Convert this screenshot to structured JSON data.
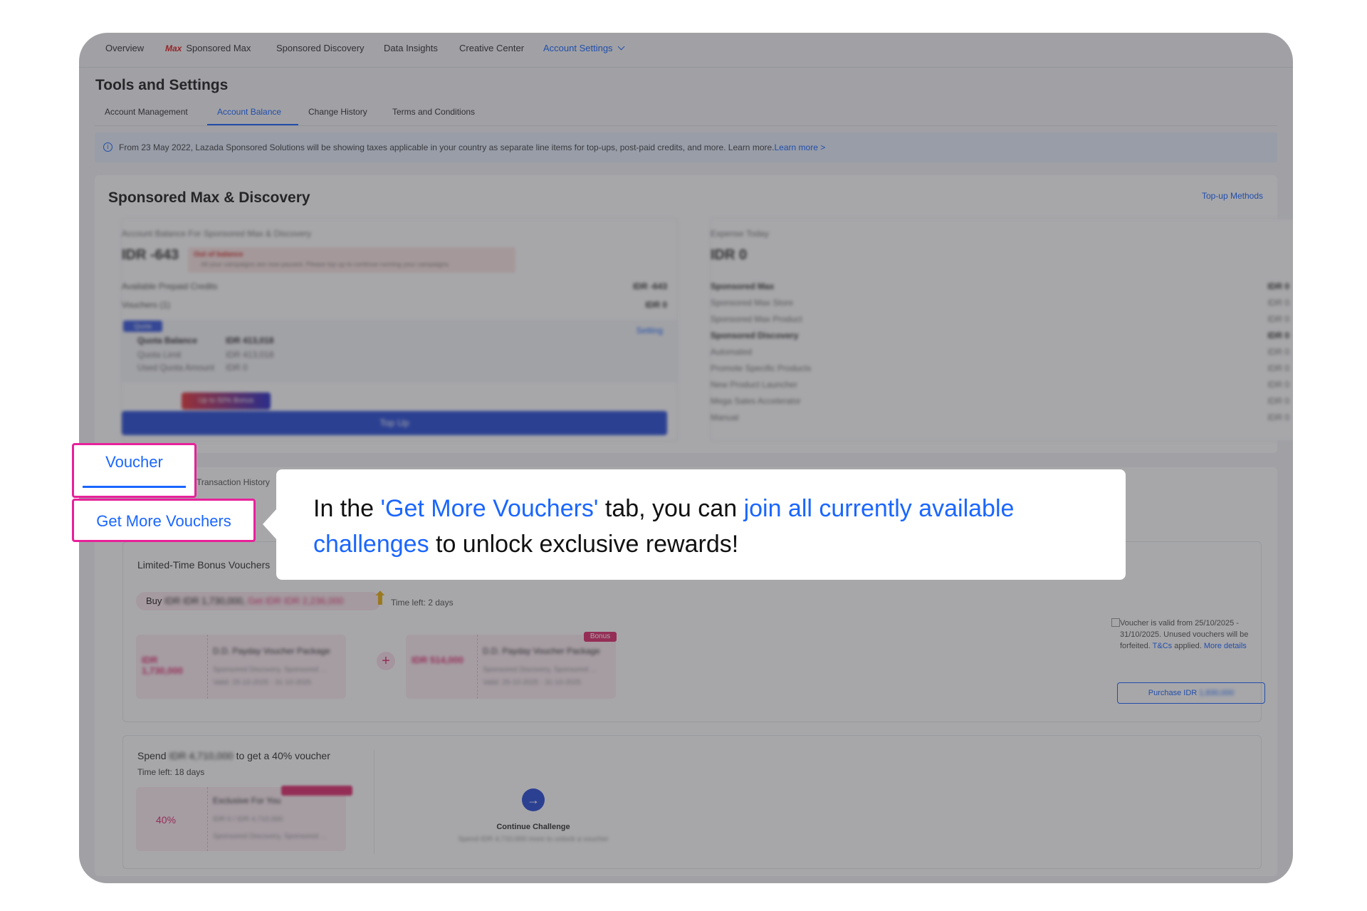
{
  "topnav": {
    "items": [
      "Overview",
      "Sponsored Max",
      "Sponsored Discovery",
      "Data Insights",
      "Creative Center",
      "Account Settings"
    ],
    "max_logo": "Max"
  },
  "page": {
    "title": "Tools and Settings",
    "tabs": [
      "Account Management",
      "Account Balance",
      "Change History",
      "Terms and Conditions"
    ],
    "active_tab": "Account Balance"
  },
  "notice": {
    "text": "From 23 May 2022, Lazada Sponsored Solutions will be showing taxes applicable in your country as separate line items for top-ups, post-paid credits, and more. Learn more.",
    "link": "Learn more >"
  },
  "balance_card": {
    "title": "Sponsored Max & Discovery",
    "topup_methods": "Top-up Methods",
    "left": {
      "label": "Account Balance For Sponsored Max & Discovery",
      "balance": "IDR -643",
      "warning_title": "Out of balance",
      "warning_text": "All your campaigns are now paused. Please top up to continue running your campaigns.",
      "rows": [
        {
          "label": "Available Prepaid Credits",
          "value": "IDR -643"
        },
        {
          "label": "Vouchers (1)",
          "value": "IDR 0"
        }
      ],
      "quota_chip": "Quota",
      "setting": "Setting",
      "quota_rows": [
        {
          "label": "Quota Balance",
          "value": "IDR 413,018"
        },
        {
          "label": "Quota Limit",
          "value": "IDR 413,018"
        },
        {
          "label": "Used Quota Amount",
          "value": "IDR 0"
        }
      ],
      "bonus_chip": "Up to 50% Bonus",
      "topup_button": "Top Up"
    },
    "right": {
      "label": "Expense Today",
      "amount": "IDR 0",
      "rows": [
        {
          "label": "Sponsored Max",
          "value": "IDR 0"
        },
        {
          "label": "Sponsored Max Store",
          "value": "IDR 0"
        },
        {
          "label": "Sponsored Max Product",
          "value": "IDR 0"
        },
        {
          "label": "Sponsored Discovery",
          "value": "IDR 0"
        },
        {
          "label": "Automated",
          "value": "IDR 0"
        },
        {
          "label": "Promote Specific Products",
          "value": "IDR 0"
        },
        {
          "label": "New Product Launcher",
          "value": "IDR 0"
        },
        {
          "label": "Mega Sales Accelerator",
          "value": "IDR 0"
        },
        {
          "label": "Manual",
          "value": "IDR 0"
        }
      ]
    }
  },
  "voucher_card": {
    "tab_voucher": "Voucher",
    "tab_history": "Transaction History",
    "subtab_get_more": "Get More Vouchers",
    "limited": {
      "title": "Limited-Time Bonus Vouchers",
      "buy_prefix": "Buy",
      "buy_amount": "IDR IDR 1,730,000,",
      "get_amount": "Get IDR IDR 2,236,000",
      "time_left": "Time left: 2 days",
      "package1": {
        "amount": "IDR 1,730,000",
        "name": "D.D. Payday Voucher Package",
        "desc": "Sponsored Discovery, Sponsored ..."
      },
      "package2": {
        "amount": "IDR 514,000",
        "name": "D.D. Payday Voucher Package",
        "desc": "Sponsored Discovery, Sponsored ..."
      },
      "package_valid": "Valid: 25-10-2025 - 31-10-2025",
      "bonus_tag": "Bonus",
      "validity": "Voucher is valid from 25/10/2025 - 31/10/2025. Unused vouchers will be forfeited.",
      "tc_link": "T&Cs",
      "tc_suffix": "applied.",
      "more_details": "More details",
      "purchase_prefix": "Purchase IDR",
      "purchase_amount": "1,830,000"
    },
    "spend": {
      "title_prefix": "Spend",
      "amount": "IDR 4,710,000",
      "title_suffix": "to get a 40% voucher",
      "time_left": "Time left: 18 days",
      "percent": "40%",
      "name": "Exclusive For You",
      "desc": "IDR 0 / IDR 4,710,000",
      "desc2": "Sponsored Discovery, Sponsored ...",
      "continue_label": "Continue Challenge",
      "continue_sub": "Spend IDR 4,710,000 more to unlock a voucher"
    }
  },
  "callout": {
    "part1": "In the ",
    "highlight1": "'Get More Vouchers'",
    "part2": " tab, you can ",
    "highlight2": "join all currently available challenges",
    "part3": " to unlock exclusive rewards!"
  },
  "colors": {
    "accent": "#1a66ff",
    "highlight_border": "#e8219a",
    "bonus_pink": "#e0306f"
  }
}
